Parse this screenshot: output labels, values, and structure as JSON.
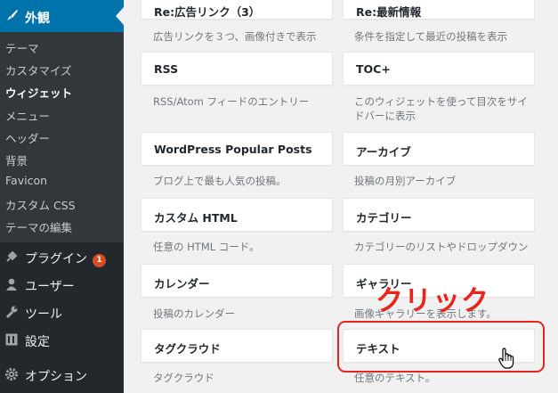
{
  "sidebar": {
    "section": "外観",
    "submenu": [
      "テーマ",
      "カスタマイズ",
      "ウィジェット",
      "メニュー",
      "ヘッダー",
      "背景",
      "Favicon",
      "カスタム CSS",
      "テーマの編集"
    ],
    "current": "ウィジェット",
    "items": [
      {
        "label": "プラグイン",
        "badge": "1",
        "icon": "plugin-icon"
      },
      {
        "label": "ユーザー",
        "icon": "user-icon"
      },
      {
        "label": "ツール",
        "icon": "wrench-icon"
      },
      {
        "label": "設定",
        "icon": "settings-icon"
      },
      {
        "label": "オプション",
        "icon": "gear-icon"
      }
    ]
  },
  "widgets": {
    "left": [
      {
        "title": "Re:広告リンク（3）",
        "desc": "広告リンクを３つ、画像付きで表示"
      },
      {
        "title": "RSS",
        "desc": "RSS/Atom フィードのエントリー"
      },
      {
        "title": "WordPress Popular Posts",
        "desc": "ブログ上で最も人気の投稿。"
      },
      {
        "title": "カスタム HTML",
        "desc": "任意の HTML コード。"
      },
      {
        "title": "カレンダー",
        "desc": "投稿のカレンダー"
      },
      {
        "title": "タグクラウド",
        "desc": "タグクラウド"
      }
    ],
    "right": [
      {
        "title": "Re:最新情報",
        "desc": "条件を指定して最近の投稿を表示"
      },
      {
        "title": "TOC+",
        "desc": "このウィジェットを使って目次をサイドバーに表示"
      },
      {
        "title": "アーカイブ",
        "desc": "投稿の月別アーカイブ"
      },
      {
        "title": "カテゴリー",
        "desc": "カテゴリーのリストやドロップダウン"
      },
      {
        "title": "ギャラリー",
        "desc": "画像ギャラリーを表示します。"
      },
      {
        "title": "テキスト",
        "desc": "任意のテキスト。"
      }
    ]
  },
  "annotation": {
    "label": "クリック",
    "color": "#e8251d"
  },
  "colors": {
    "sidebar": "#23282d",
    "submenu": "#32373c",
    "accent": "#0073aa",
    "badge": "#d54e21"
  }
}
